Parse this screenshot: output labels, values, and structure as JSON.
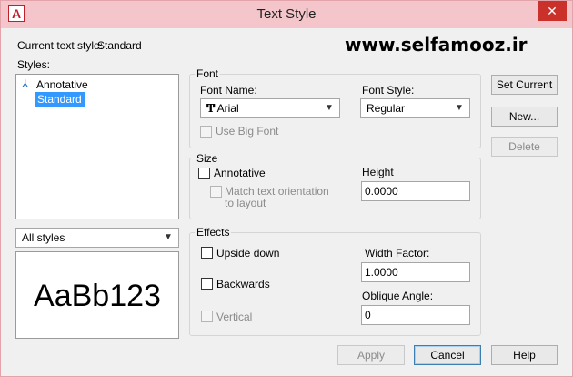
{
  "window": {
    "title": "Text Style",
    "app_icon_letter": "A",
    "close_glyph": "✕"
  },
  "watermark": "www.selfamooz.ir",
  "current_style": {
    "label": "Current text style:",
    "value": "Standard"
  },
  "styles": {
    "label": "Styles:",
    "items": [
      {
        "label": "Annotative",
        "icon": "annotative-icon"
      },
      {
        "label": "Standard",
        "selected": true
      }
    ],
    "filter_value": "All styles"
  },
  "preview": {
    "text": "AaBb123"
  },
  "font": {
    "group_label": "Font",
    "name_label": "Font Name:",
    "name_value": "Arial",
    "name_icon": "truetype-font-icon",
    "style_label": "Font Style:",
    "style_value": "Regular",
    "big_font_label": "Use Big Font"
  },
  "size": {
    "group_label": "Size",
    "annotative_label": "Annotative",
    "match_label_line1": "Match text orientation",
    "match_label_line2": "to layout",
    "height_label": "Height",
    "height_value": "0.0000"
  },
  "effects": {
    "group_label": "Effects",
    "upside_down_label": "Upside down",
    "backwards_label": "Backwards",
    "vertical_label": "Vertical",
    "width_factor_label": "Width Factor:",
    "width_factor_value": "1.0000",
    "oblique_label": "Oblique Angle:",
    "oblique_value": "0"
  },
  "buttons": {
    "set_current": "Set Current",
    "new": "New...",
    "delete": "Delete",
    "apply": "Apply",
    "cancel": "Cancel",
    "help": "Help"
  }
}
